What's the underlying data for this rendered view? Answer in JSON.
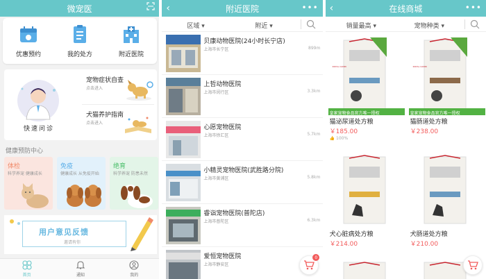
{
  "panel1": {
    "title": "微宠医",
    "quick": [
      {
        "label": "优惠预约",
        "icon": "calendar-icon"
      },
      {
        "label": "我的处方",
        "icon": "prescription-icon"
      },
      {
        "label": "附近医院",
        "icon": "hospital-icon"
      }
    ],
    "consult": {
      "label": "快速问诊",
      "items": [
        {
          "title": "宠物症状自查",
          "sub": "点击进入"
        },
        {
          "title": "犬猫养护指南",
          "sub": "点击进入"
        }
      ]
    },
    "section_title": "健康预防中心",
    "health": [
      {
        "title": "体检",
        "sub": "科学养宠  健康成长",
        "color": "#f08a6a",
        "bg": "#fbe5df"
      },
      {
        "title": "免疫",
        "sub": "健康成长  从免疫开始",
        "color": "#5aaee8",
        "bg": "#e2f1fb"
      },
      {
        "title": "绝育",
        "sub": "科学养宠  防患未然",
        "color": "#4cbf6c",
        "bg": "#e3f5e8"
      }
    ],
    "banner": {
      "title": "用户意见反馈",
      "sub": "邀请有你"
    },
    "nav": [
      {
        "label": "首页",
        "icon": "home-icon"
      },
      {
        "label": "通知",
        "icon": "bell-icon"
      },
      {
        "label": "我的",
        "icon": "user-icon"
      }
    ]
  },
  "panel2": {
    "title": "附近医院",
    "filter1": "区域",
    "filter2": "附近",
    "hospitals": [
      {
        "name": "贝康动物医院(24小时长宁店)",
        "area": "上海市长宁区",
        "dist": "899m"
      },
      {
        "name": "上哲动物医院",
        "area": "上海市闵行区",
        "dist": "3.3km"
      },
      {
        "name": "心愿宠物医院",
        "area": "上海市徐汇区",
        "dist": "5.7km"
      },
      {
        "name": "小精灵宠物医院(武胜路分院)",
        "area": "上海市黄浦区",
        "dist": "5.8km"
      },
      {
        "name": "睿诣宠物医院(普陀店)",
        "area": "上海市普陀区",
        "dist": "6.3km"
      },
      {
        "name": "爱恒宠物医院",
        "area": "上海市静安区",
        "dist": ""
      }
    ],
    "cart_count": "0"
  },
  "panel3": {
    "title": "在线商城",
    "filter1": "销量最高",
    "filter2": "宠物种类",
    "products": [
      {
        "name": "猫泌尿道处方粮",
        "price": "￥185.00",
        "rating": "100%",
        "stripe": "皇家宠物食品官方唯一授权"
      },
      {
        "name": "猫肠道处方粮",
        "price": "￥238.00",
        "rating": "",
        "stripe": "皇家宠物食品官方唯一授权"
      },
      {
        "name": "犬心脏病处方粮",
        "price": "￥214.00",
        "rating": "",
        "stripe": ""
      },
      {
        "name": "犬肠道处方粮",
        "price": "￥210.00",
        "rating": "",
        "stripe": ""
      }
    ],
    "brand": "ROYAL CANIN",
    "cart_icon": "cart-icon"
  },
  "colors": {
    "accent": "#67c7c9",
    "price": "#f25a5a",
    "stripe": "#52b243"
  }
}
